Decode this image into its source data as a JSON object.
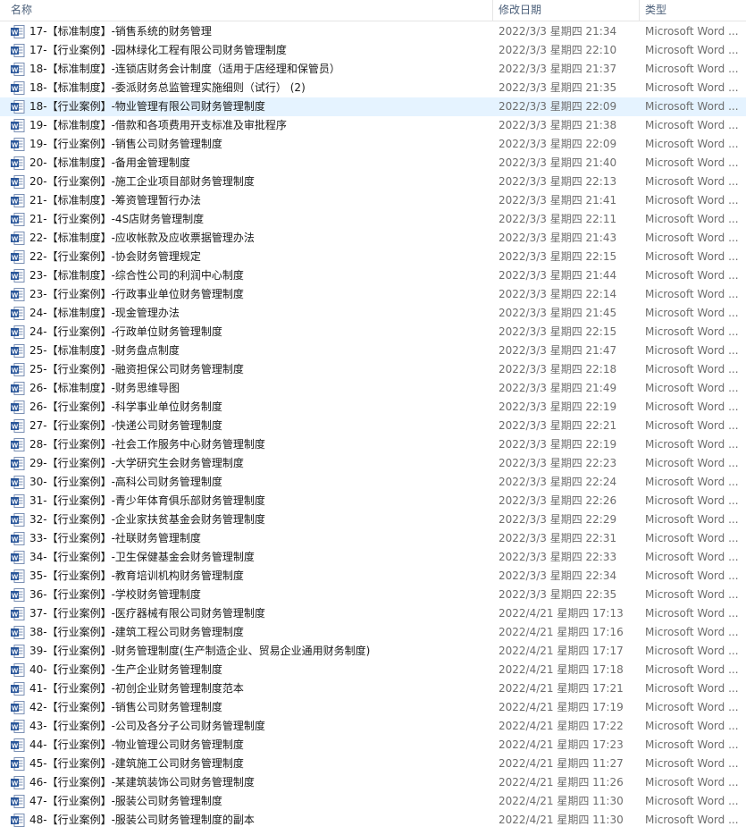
{
  "header": {
    "name_label": "名称",
    "date_label": "修改日期",
    "type_label": "类型",
    "sort_glyph": "^"
  },
  "colors": {
    "selected_row": "#e5f3ff",
    "word_icon": "#2b579a"
  },
  "icon_name": "word-document-icon",
  "files": [
    {
      "name": "17-【标准制度】-销售系统的财务管理",
      "date": "2022/3/3 星期四 21:34",
      "type": "Microsoft Word ..."
    },
    {
      "name": "17-【行业案例】-园林绿化工程有限公司财务管理制度",
      "date": "2022/3/3 星期四 22:10",
      "type": "Microsoft Word ..."
    },
    {
      "name": "18-【标准制度】-连锁店财务会计制度（适用于店经理和保管员）",
      "date": "2022/3/3 星期四 21:37",
      "type": "Microsoft Word ..."
    },
    {
      "name": "18-【标准制度】-委派财务总监管理实施细则（试行） (2)",
      "date": "2022/3/3 星期四 21:35",
      "type": "Microsoft Word ..."
    },
    {
      "name": "18-【行业案例】-物业管理有限公司财务管理制度",
      "date": "2022/3/3 星期四 22:09",
      "type": "Microsoft Word ...",
      "selected": true
    },
    {
      "name": "19-【标准制度】-借款和各项费用开支标准及审批程序",
      "date": "2022/3/3 星期四 21:38",
      "type": "Microsoft Word ..."
    },
    {
      "name": "19-【行业案例】-销售公司财务管理制度",
      "date": "2022/3/3 星期四 22:09",
      "type": "Microsoft Word ..."
    },
    {
      "name": "20-【标准制度】-备用金管理制度",
      "date": "2022/3/3 星期四 21:40",
      "type": "Microsoft Word ..."
    },
    {
      "name": "20-【行业案例】-施工企业项目部财务管理制度",
      "date": "2022/3/3 星期四 22:13",
      "type": "Microsoft Word ..."
    },
    {
      "name": "21-【标准制度】-筹资管理暂行办法",
      "date": "2022/3/3 星期四 21:41",
      "type": "Microsoft Word ..."
    },
    {
      "name": "21-【行业案例】-4S店财务管理制度",
      "date": "2022/3/3 星期四 22:11",
      "type": "Microsoft Word ..."
    },
    {
      "name": "22-【标准制度】-应收帐款及应收票据管理办法",
      "date": "2022/3/3 星期四 21:43",
      "type": "Microsoft Word ..."
    },
    {
      "name": "22-【行业案例】-协会财务管理规定",
      "date": "2022/3/3 星期四 22:15",
      "type": "Microsoft Word ..."
    },
    {
      "name": "23-【标准制度】-综合性公司的利润中心制度",
      "date": "2022/3/3 星期四 21:44",
      "type": "Microsoft Word ..."
    },
    {
      "name": "23-【行业案例】-行政事业单位财务管理制度",
      "date": "2022/3/3 星期四 22:14",
      "type": "Microsoft Word ..."
    },
    {
      "name": "24-【标准制度】-现金管理办法",
      "date": "2022/3/3 星期四 21:45",
      "type": "Microsoft Word ..."
    },
    {
      "name": "24-【行业案例】-行政单位财务管理制度",
      "date": "2022/3/3 星期四 22:15",
      "type": "Microsoft Word ..."
    },
    {
      "name": "25-【标准制度】-财务盘点制度",
      "date": "2022/3/3 星期四 21:47",
      "type": "Microsoft Word ..."
    },
    {
      "name": "25-【行业案例】-融资担保公司财务管理制度",
      "date": "2022/3/3 星期四 22:18",
      "type": "Microsoft Word ..."
    },
    {
      "name": "26-【标准制度】-财务思维导图",
      "date": "2022/3/3 星期四 21:49",
      "type": "Microsoft Word ..."
    },
    {
      "name": "26-【行业案例】-科学事业单位财务制度",
      "date": "2022/3/3 星期四 22:19",
      "type": "Microsoft Word ..."
    },
    {
      "name": "27-【行业案例】-快递公司财务管理制度",
      "date": "2022/3/3 星期四 22:21",
      "type": "Microsoft Word ..."
    },
    {
      "name": "28-【行业案例】-社会工作服务中心财务管理制度",
      "date": "2022/3/3 星期四 22:19",
      "type": "Microsoft Word ..."
    },
    {
      "name": "29-【行业案例】-大学研究生会财务管理制度",
      "date": "2022/3/3 星期四 22:23",
      "type": "Microsoft Word ..."
    },
    {
      "name": "30-【行业案例】-高科公司财务管理制度",
      "date": "2022/3/3 星期四 22:24",
      "type": "Microsoft Word ..."
    },
    {
      "name": "31-【行业案例】-青少年体育俱乐部财务管理制度",
      "date": "2022/3/3 星期四 22:26",
      "type": "Microsoft Word ..."
    },
    {
      "name": "32-【行业案例】-企业家扶贫基金会财务管理制度",
      "date": "2022/3/3 星期四 22:29",
      "type": "Microsoft Word ..."
    },
    {
      "name": "33-【行业案例】-社联财务管理制度",
      "date": "2022/3/3 星期四 22:31",
      "type": "Microsoft Word ..."
    },
    {
      "name": "34-【行业案例】-卫生保健基金会财务管理制度",
      "date": "2022/3/3 星期四 22:33",
      "type": "Microsoft Word ..."
    },
    {
      "name": "35-【行业案例】-教育培训机构财务管理制度",
      "date": "2022/3/3 星期四 22:34",
      "type": "Microsoft Word ..."
    },
    {
      "name": "36-【行业案例】-学校财务管理制度",
      "date": "2022/3/3 星期四 22:35",
      "type": "Microsoft Word ..."
    },
    {
      "name": "37-【行业案例】-医疗器械有限公司财务管理制度",
      "date": "2022/4/21 星期四 17:13",
      "type": "Microsoft Word ..."
    },
    {
      "name": "38-【行业案例】-建筑工程公司财务管理制度",
      "date": "2022/4/21 星期四 17:16",
      "type": "Microsoft Word ..."
    },
    {
      "name": "39-【行业案例】-财务管理制度(生产制造企业、贸易企业通用财务制度)",
      "date": "2022/4/21 星期四 17:17",
      "type": "Microsoft Word ..."
    },
    {
      "name": "40-【行业案例】-生产企业财务管理制度",
      "date": "2022/4/21 星期四 17:18",
      "type": "Microsoft Word ..."
    },
    {
      "name": "41-【行业案例】-初创企业财务管理制度范本",
      "date": "2022/4/21 星期四 17:21",
      "type": "Microsoft Word ..."
    },
    {
      "name": "42-【行业案例】-销售公司财务管理制度",
      "date": "2022/4/21 星期四 17:19",
      "type": "Microsoft Word ..."
    },
    {
      "name": "43-【行业案例】-公司及各分子公司财务管理制度",
      "date": "2022/4/21 星期四 17:22",
      "type": "Microsoft Word ..."
    },
    {
      "name": "44-【行业案例】-物业管理公司财务管理制度",
      "date": "2022/4/21 星期四 17:23",
      "type": "Microsoft Word ..."
    },
    {
      "name": "45-【行业案例】-建筑施工公司财务管理制度",
      "date": "2022/4/21 星期四 11:27",
      "type": "Microsoft Word ..."
    },
    {
      "name": "46-【行业案例】-某建筑装饰公司财务管理制度",
      "date": "2022/4/21 星期四 11:26",
      "type": "Microsoft Word ..."
    },
    {
      "name": "47-【行业案例】-服装公司财务管理制度",
      "date": "2022/4/21 星期四 11:30",
      "type": "Microsoft Word ..."
    },
    {
      "name": "48-【行业案例】-服装公司财务管理制度的副本",
      "date": "2022/4/21 星期四 11:30",
      "type": "Microsoft Word ..."
    }
  ]
}
